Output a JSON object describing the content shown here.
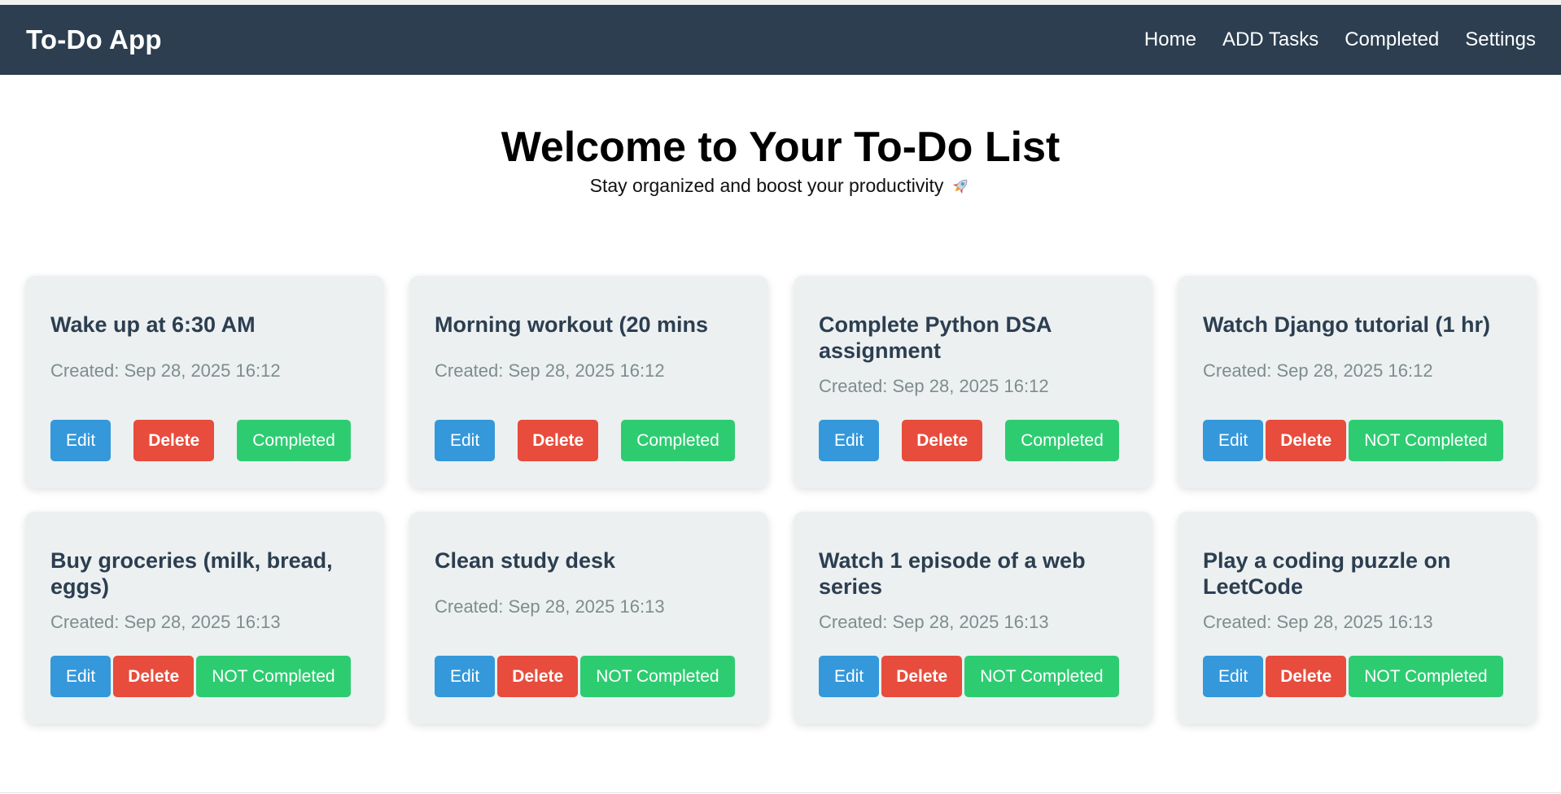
{
  "navbar": {
    "brand": "To-Do App",
    "links": [
      "Home",
      "ADD Tasks",
      "Completed",
      "Settings"
    ]
  },
  "hero": {
    "title": "Welcome to Your To-Do List",
    "subtitle": "Stay organized and boost your productivity"
  },
  "icons": {
    "subtitle_icon": "rocket-icon"
  },
  "colors": {
    "navbar": "#2c3e50",
    "card_bg": "#ecf0f1",
    "edit": "#3498db",
    "delete": "#e74c3c",
    "status": "#2ecc71",
    "title": "#2c3e50",
    "created": "#7f8c8d"
  },
  "buttons": {
    "edit": "Edit",
    "delete": "Delete"
  },
  "tasks": [
    {
      "title": "Wake up at 6:30 AM",
      "created": "Created: Sep 28, 2025 16:12",
      "status": "Completed"
    },
    {
      "title": "Morning workout (20 mins",
      "created": "Created: Sep 28, 2025 16:12",
      "status": "Completed"
    },
    {
      "title": "Complete Python DSA assignment",
      "created": "Created: Sep 28, 2025 16:12",
      "status": "Completed"
    },
    {
      "title": "Watch Django tutorial (1 hr)",
      "created": "Created: Sep 28, 2025 16:12",
      "status": "NOT Completed"
    },
    {
      "title": "Buy groceries (milk, bread, eggs)",
      "created": "Created: Sep 28, 2025 16:13",
      "status": "NOT Completed"
    },
    {
      "title": "Clean study desk",
      "created": "Created: Sep 28, 2025 16:13",
      "status": "NOT Completed"
    },
    {
      "title": "Watch 1 episode of a web series",
      "created": "Created: Sep 28, 2025 16:13",
      "status": "NOT Completed"
    },
    {
      "title": "Play a coding puzzle on LeetCode",
      "created": "Created: Sep 28, 2025 16:13",
      "status": "NOT Completed"
    }
  ]
}
